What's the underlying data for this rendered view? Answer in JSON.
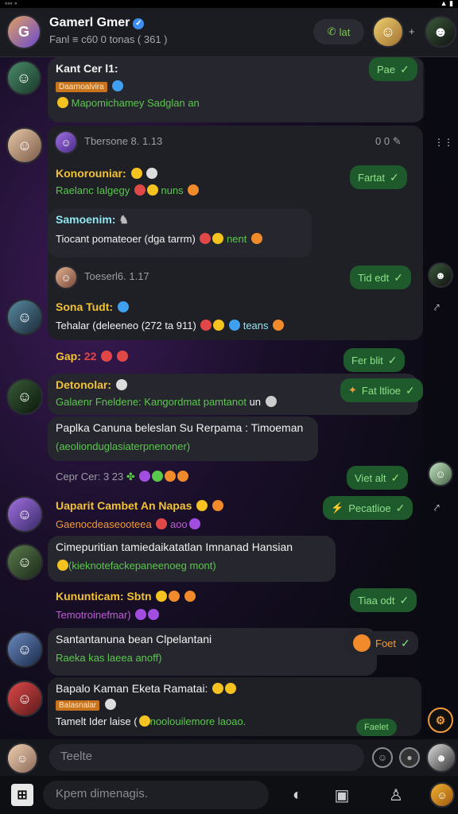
{
  "header": {
    "title": "Gamerl Gmer",
    "subtitle": "Fanl ≡ c60 0 tonas ( 361 )",
    "call_label": "lat"
  },
  "messages": [
    {
      "name": "Kant Cer l1:",
      "tag": "Daarnoalvira",
      "text": "Mapomichamey Sadglan an"
    },
    {
      "date": "Tbersone 8. 1.13",
      "counter": "0 0"
    },
    {
      "name": "Konorouniar:",
      "text": "Raelanc Ialgegy",
      "text_tail": "nuns",
      "ack": "Fartat"
    },
    {
      "name": "Samoenim:",
      "text": "Tiocant pomateoer (dga tarrm)",
      "text_tail": "nent"
    },
    {
      "date": "Toeserl6. 1.17",
      "ack": "Tid edt"
    },
    {
      "name": "Sona Tudt:",
      "text": "Tehalar (deleeneo (272 ta 911)",
      "text_tail": "teans"
    },
    {
      "name": "Gap:",
      "text": "22",
      "ack": "Fer blit"
    },
    {
      "name": "Detonolar:",
      "text": "Galaenr Fneldene: Kangordmat pamtanot",
      "text_tail": "un",
      "ack": "Fat ltlioe"
    },
    {
      "name": "Paplka Canuna beleslan Su Rerpama : Timoeman",
      "text": "(aeolionduglasiaterpnenoner)"
    },
    {
      "date": "Cepr Cer: 3 23"
    },
    {
      "name": "Uaparit Cambet An Napas",
      "text": "Gaenocdeaseooteea",
      "text_tail": "aoo",
      "ack": "Viet alt"
    },
    {
      "ack": "Pecatlioe"
    },
    {
      "name": "Cimepuritian tamiedaikatatlan Imnanad Hansian",
      "text": "(kieknotefackepaneenoeg mont)"
    },
    {
      "name": "Kununticam: Sbtn",
      "text": "Temotroinefmar)",
      "ack": "Tiaa odt"
    },
    {
      "name": "Santantanuna bean Clpelantani",
      "text": "Raeka kas laeea anoff)",
      "ack": "Foet"
    },
    {
      "name": "Bapalo Kaman Eketa Ramatai:",
      "tag": "Balasnalar",
      "text": "Tamelt Ider laise (",
      "text_tail": "noolouilemore laoao.",
      "ack": "Faelet"
    }
  ],
  "input": {
    "placeholder": "Teelte"
  },
  "bottom": {
    "search_placeholder": "Kpem dimenagis."
  },
  "colors": {
    "accent_green": "#1e5a2c",
    "name_yellow": "#f2c233",
    "text_green": "#58c84a"
  }
}
